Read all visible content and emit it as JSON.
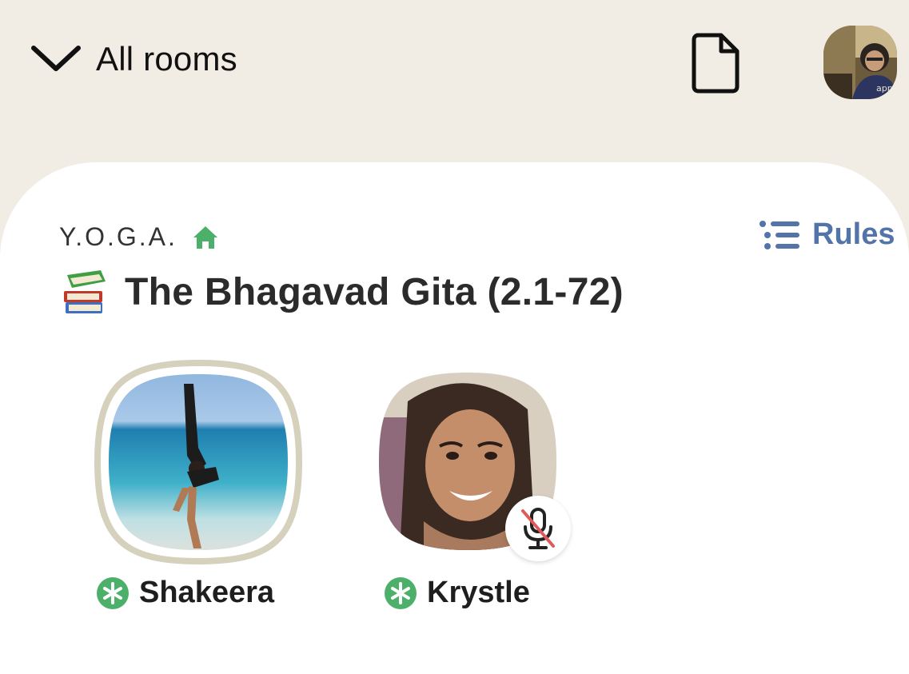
{
  "header": {
    "all_rooms_label": "All rooms"
  },
  "room": {
    "club_name": "Y.O.G.A.",
    "rules_label": "Rules",
    "title": "The Bhagavad Gita (2.1-72)"
  },
  "speakers": [
    {
      "name": "Shakeera",
      "speaking": true,
      "muted": false
    },
    {
      "name": "Krystle",
      "speaking": false,
      "muted": true
    }
  ],
  "colors": {
    "header_bg": "#f1ede4",
    "card_bg": "#ffffff",
    "accent_green": "#4caf6a",
    "rules_blue": "#5374a8",
    "speaking_ring": "#d6d1bd"
  },
  "icons": {
    "all_rooms": "chevron-down-icon",
    "document": "document-icon",
    "home": "home-icon",
    "rules": "list-icon",
    "books": "books-emoji-icon",
    "moderator": "moderator-star-icon",
    "muted": "mic-off-icon"
  }
}
